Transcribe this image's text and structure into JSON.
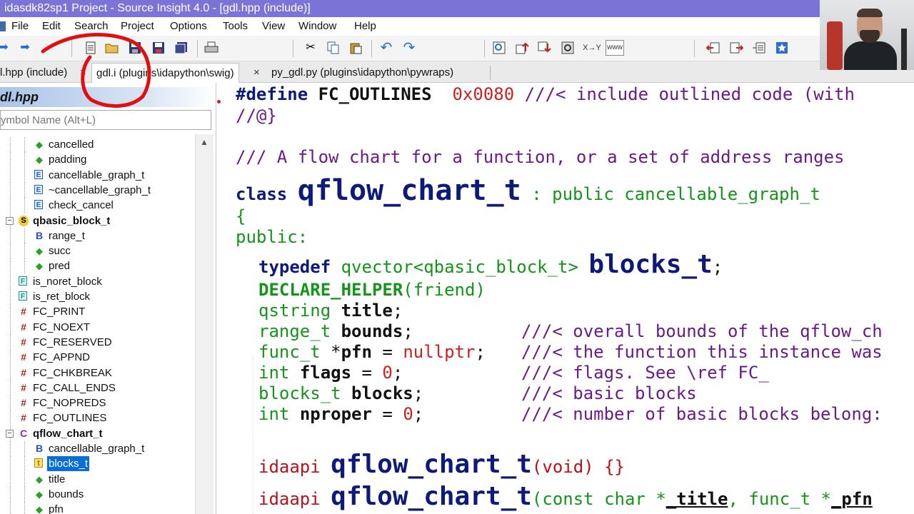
{
  "window": {
    "title": "idasdk82sp1 Project - Source Insight 4.0 - [gdl.hpp (include)]"
  },
  "menubar": {
    "items": [
      "File",
      "Edit",
      "Search",
      "Project",
      "Options",
      "Tools",
      "View",
      "Window",
      "Help"
    ]
  },
  "toolbar": {
    "icons": [
      "back-arrow-icon",
      "forward-arrow-icon",
      "new-file-icon",
      "open-folder-icon",
      "save-icon",
      "save-as-icon",
      "save-all-icon",
      "print-icon",
      "cut-icon",
      "copy-icon",
      "paste-icon",
      "undo-icon",
      "redo-icon",
      "find-icon",
      "search-up-icon",
      "search-down-icon",
      "search-project-icon",
      "replace-icon",
      "browse-web-icon",
      "jump-prev-icon",
      "jump-next-icon",
      "symbol-window-icon",
      "bookmark-icon"
    ],
    "replace_label": "X→Y",
    "www_label": "www"
  },
  "tabs": [
    {
      "label": "l.hpp (include)",
      "active": false
    },
    {
      "label": "gdl.i (plugins\\idapython\\swig)",
      "active": true
    },
    {
      "label": "py_gdl.py (plugins\\idapython\\pywraps)",
      "active": false
    }
  ],
  "tab_close_glyph": "×",
  "sidebar": {
    "title": "dl.hpp",
    "search_placeholder": "ymbol Name (Alt+L)",
    "tree": [
      {
        "label": "cancelled",
        "icon": "diamond",
        "level": 2
      },
      {
        "label": "padding",
        "icon": "diamond",
        "level": 2
      },
      {
        "label": "cancellable_graph_t",
        "icon": "method",
        "level": 2
      },
      {
        "label": "~cancellable_graph_t",
        "icon": "method",
        "level": 2
      },
      {
        "label": "check_cancel",
        "icon": "method",
        "level": 2
      },
      {
        "label": "qbasic_block_t",
        "icon": "struct",
        "level": 1,
        "expander": "−",
        "bold": true
      },
      {
        "label": "range_t",
        "icon": "field",
        "level": 2
      },
      {
        "label": "succ",
        "icon": "diamond",
        "level": 2
      },
      {
        "label": "pred",
        "icon": "diamond",
        "level": 2
      },
      {
        "label": "is_noret_block",
        "icon": "func",
        "level": 1
      },
      {
        "label": "is_ret_block",
        "icon": "func",
        "level": 1
      },
      {
        "label": "FC_PRINT",
        "icon": "macro",
        "level": 1
      },
      {
        "label": "FC_NOEXT",
        "icon": "macro",
        "level": 1
      },
      {
        "label": "FC_RESERVED",
        "icon": "macro",
        "level": 1
      },
      {
        "label": "FC_APPND",
        "icon": "macro",
        "level": 1
      },
      {
        "label": "FC_CHKBREAK",
        "icon": "macro",
        "level": 1
      },
      {
        "label": "FC_CALL_ENDS",
        "icon": "macro",
        "level": 1
      },
      {
        "label": "FC_NOPREDS",
        "icon": "macro",
        "level": 1
      },
      {
        "label": "FC_OUTLINES",
        "icon": "macro",
        "level": 1
      },
      {
        "label": "qflow_chart_t",
        "icon": "cls",
        "level": 1,
        "expander": "−",
        "bold": true
      },
      {
        "label": "cancellable_graph_t",
        "icon": "field",
        "level": 2
      },
      {
        "label": "blocks_t",
        "icon": "typedef",
        "level": 2,
        "selected": true
      },
      {
        "label": "title",
        "icon": "diamond",
        "level": 2
      },
      {
        "label": "bounds",
        "icon": "diamond",
        "level": 2
      },
      {
        "label": "pfn",
        "icon": "diamond",
        "level": 2
      }
    ],
    "icon_glyphs": {
      "diamond": "◆",
      "method": "E",
      "field": "B",
      "struct": "S",
      "cls": "C",
      "func": "F",
      "macro": "#",
      "typedef": "t"
    }
  },
  "editor": {
    "line1": {
      "directive": "#define",
      "name": "FC_OUTLINES",
      "value": "0x0080",
      "comment": "///< include outlined code (with"
    },
    "line2": {
      "comment": "//@}"
    },
    "line3": {
      "comment": "/// A flow chart for a function, or a set of address ranges"
    },
    "line4": {
      "keyword": "class",
      "name": "qflow_chart_t",
      "base": ": public cancellable_graph_t"
    },
    "line5": {
      "text": "{"
    },
    "line6": {
      "text": "public:"
    },
    "line7": {
      "keyword": "typedef",
      "type": "qvector<qbasic_block_t>",
      "name": "blocks_t",
      "end": ";"
    },
    "line8": {
      "macro": "DECLARE_HELPER",
      "args": "(friend)"
    },
    "line9": {
      "type": "qstring",
      "name": "title",
      "end": ";"
    },
    "line10": {
      "type": "range_t",
      "name": "bounds",
      "end": ";",
      "comment": "///< overall bounds of the qflow_ch"
    },
    "line11": {
      "type": "func_t",
      "star": " *",
      "name": "pfn",
      "eq": " = ",
      "value": "nullptr",
      "end": ";",
      "comment": "///< the function this instance was"
    },
    "line12": {
      "type": "int",
      "name": "flags",
      "eq": " = ",
      "value": "0",
      "end": ";",
      "comment": "///< flags. See \\ref FC_"
    },
    "line13": {
      "type": "blocks_t",
      "name": "blocks",
      "end": ";",
      "comment": "///< basic blocks"
    },
    "line14": {
      "type": "int",
      "name": "nproper",
      "eq": " = ",
      "value": "0",
      "end": ";",
      "comment": "///< number of basic blocks belong:"
    },
    "line15": {
      "prefix": "idaapi",
      "name": "qflow_chart_t",
      "args": "(void) {}"
    },
    "line16": {
      "prefix": "idaapi",
      "name": "qflow_chart_t",
      "args_open": "(const char *",
      "arg1": "_title",
      "args_mid": ", func_t *",
      "arg2": "_pfn"
    }
  },
  "colors": {
    "titlebar": "#7b74d6",
    "selection": "#0a6ed8",
    "keyword": "#0d1a7a",
    "number": "#cf1f1f",
    "comment": "#6a1a8a",
    "green": "#14941a",
    "annotation": "#e01010"
  }
}
